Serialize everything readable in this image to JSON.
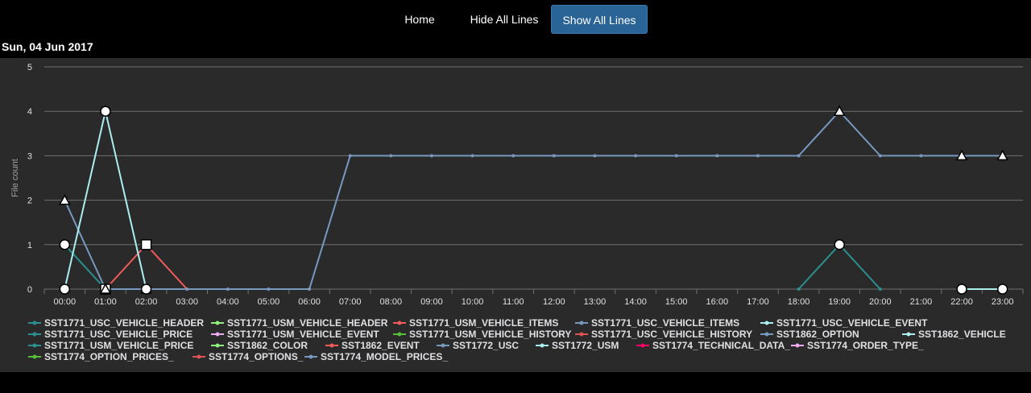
{
  "nav": {
    "home": "Home",
    "hide_all": "Hide All Lines",
    "show_all": "Show All Lines"
  },
  "date_title": "Sun, 04 Jun 2017",
  "colors": {
    "background": "#2a2a2b",
    "active_button": "#2a6496"
  },
  "chart_data": {
    "type": "line",
    "ylabel": "File count",
    "xlabel": "",
    "ylim": [
      0,
      5
    ],
    "yticks": [
      "0",
      "1",
      "2",
      "3",
      "4",
      "5"
    ],
    "grid": true,
    "legend_position": "bottom",
    "categories": [
      "00:00",
      "01:00",
      "02:00",
      "03:00",
      "04:00",
      "05:00",
      "06:00",
      "07:00",
      "08:00",
      "09:00",
      "10:00",
      "11:00",
      "12:00",
      "13:00",
      "14:00",
      "15:00",
      "16:00",
      "17:00",
      "18:00",
      "19:00",
      "20:00",
      "21:00",
      "22:00",
      "23:00"
    ],
    "series": [
      {
        "name": "SST1771_USC_VEHICLE_HEADER",
        "color": "#2b908f",
        "values": [
          1,
          0,
          null,
          null,
          null,
          null,
          null,
          null,
          null,
          null,
          null,
          null,
          null,
          null,
          null,
          null,
          null,
          null,
          0,
          1,
          0,
          null,
          null,
          null
        ]
      },
      {
        "name": "SST1771_USM_VEHICLE_HEADER",
        "color": "#90ee7e",
        "values": []
      },
      {
        "name": "SST1771_USM_VEHICLE_ITEMS",
        "color": "#f45b5b",
        "values": [
          null,
          0,
          1,
          0,
          null,
          null,
          null,
          null,
          null,
          null,
          null,
          null,
          null,
          null,
          null,
          null,
          null,
          null,
          null,
          null,
          null,
          null,
          null,
          null
        ]
      },
      {
        "name": "SST1771_USC_VEHICLE_ITEMS",
        "color": "#7798bf",
        "values": [
          2,
          0,
          0,
          0,
          0,
          0,
          0,
          3,
          3,
          3,
          3,
          3,
          3,
          3,
          3,
          3,
          3,
          3,
          3,
          4,
          3,
          3,
          3,
          3
        ]
      },
      {
        "name": "SST1771_USC_VEHICLE_EVENT",
        "color": "#aaeeee",
        "values": [
          0,
          4,
          0,
          null,
          null,
          null,
          null,
          null,
          null,
          null,
          null,
          null,
          null,
          null,
          null,
          null,
          null,
          null,
          null,
          null,
          null,
          null,
          0,
          0
        ]
      },
      {
        "name": "SST1771_USC_VEHICLE_PRICE",
        "color": "#2b908f",
        "values": []
      },
      {
        "name": "SST1771_USM_VEHICLE_EVENT",
        "color": "#eeaaee",
        "values": []
      },
      {
        "name": "SST1771_USM_VEHICLE_HISTORY",
        "color": "#55bf3b",
        "values": []
      },
      {
        "name": "SST1771_USC_VEHICLE_HISTORY",
        "color": "#df5353",
        "values": []
      },
      {
        "name": "SST1862_OPTION",
        "color": "#7798bf",
        "values": []
      },
      {
        "name": "SST1862_VEHICLE",
        "color": "#aaeeee",
        "values": []
      },
      {
        "name": "SST1771_USM_VEHICLE_PRICE",
        "color": "#2b908f",
        "values": []
      },
      {
        "name": "SST1862_COLOR",
        "color": "#90ee7e",
        "values": []
      },
      {
        "name": "SST1862_EVENT",
        "color": "#f45b5b",
        "values": []
      },
      {
        "name": "SST1772_USC",
        "color": "#7798bf",
        "values": []
      },
      {
        "name": "SST1772_USM",
        "color": "#aaeeee",
        "values": []
      },
      {
        "name": "SST1774_TECHNICAL_DATA_",
        "color": "#ff0066",
        "values": []
      },
      {
        "name": "SST1774_ORDER_TYPE_",
        "color": "#eeaaee",
        "values": []
      },
      {
        "name": "SST1774_OPTION_PRICES_",
        "color": "#55bf3b",
        "values": []
      },
      {
        "name": "SST1774_OPTIONS_",
        "color": "#df5353",
        "values": []
      },
      {
        "name": "SST1774_MODEL_PRICES_",
        "color": "#7798bf",
        "values": []
      }
    ]
  }
}
